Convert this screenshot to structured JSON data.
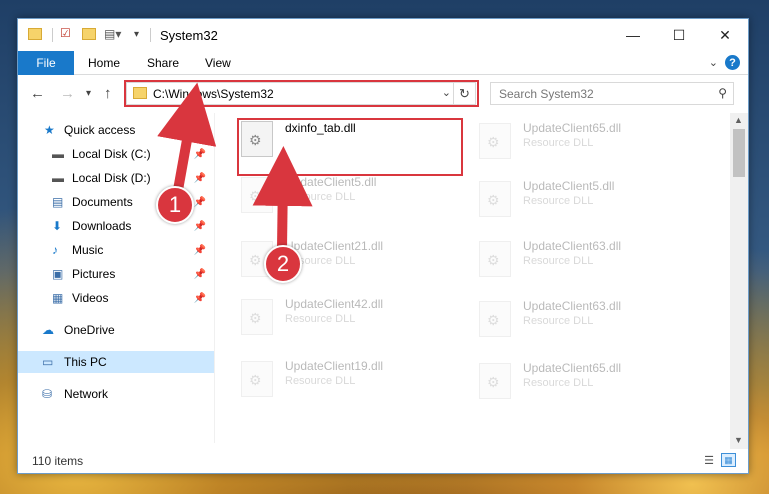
{
  "window": {
    "title": "System32",
    "minimize": "—",
    "maximize": "☐",
    "close": "✕"
  },
  "ribbon": {
    "file": "File",
    "home": "Home",
    "share": "Share",
    "view": "View",
    "help": "?"
  },
  "nav": {
    "address": "C:\\Windows\\System32",
    "search_placeholder": "Search System32"
  },
  "sidebar": {
    "items": [
      {
        "label": "Quick access",
        "icon": "star-icon"
      },
      {
        "label": "Local Disk (C:)",
        "icon": "drive-icon"
      },
      {
        "label": "Local Disk (D:)",
        "icon": "drive-icon"
      },
      {
        "label": "Documents",
        "icon": "documents-icon"
      },
      {
        "label": "Downloads",
        "icon": "download-icon"
      },
      {
        "label": "Music",
        "icon": "music-icon"
      },
      {
        "label": "Pictures",
        "icon": "pictures-icon"
      },
      {
        "label": "Videos",
        "icon": "videos-icon"
      },
      {
        "label": "OneDrive",
        "icon": "cloud-icon"
      },
      {
        "label": "This PC",
        "icon": "computer-icon"
      },
      {
        "label": "Network",
        "icon": "network-icon"
      }
    ]
  },
  "files": {
    "highlighted": {
      "name": "dxinfo_tab.dll"
    },
    "left_column": [
      {
        "name": "UpdateClient5.dll",
        "type": "Resource DLL"
      },
      {
        "name": "UpdateClient21.dll",
        "type": "Resource DLL"
      },
      {
        "name": "UpdateClient42.dll",
        "type": "Resource DLL"
      },
      {
        "name": "UpdateClient19.dll",
        "type": "Resource DLL"
      }
    ],
    "right_column": [
      {
        "name": "UpdateClient65.dll",
        "type": "Resource DLL"
      },
      {
        "name": "UpdateClient5.dll",
        "type": "Resource DLL"
      },
      {
        "name": "UpdateClient63.dll",
        "type": "Resource DLL"
      },
      {
        "name": "UpdateClient63.dll",
        "type": "Resource DLL"
      },
      {
        "name": "UpdateClient65.dll",
        "type": "Resource DLL"
      }
    ]
  },
  "status": {
    "item_count": "110 items"
  },
  "annotations": {
    "step1": "1",
    "step2": "2",
    "color": "#d9363e"
  }
}
